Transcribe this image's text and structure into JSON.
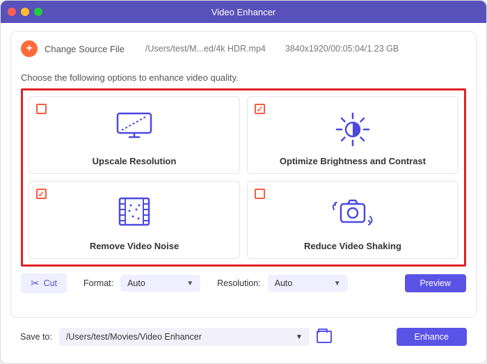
{
  "titlebar": {
    "title": "Video Enhancer"
  },
  "source": {
    "change_label": "Change Source File",
    "path": "/Users/test/M...ed/4k HDR.mp4",
    "meta": "3840x1920/00:05:04/1.23 GB"
  },
  "choose_label": "Choose the following options to enhance video quality.",
  "options": {
    "upscale": {
      "title": "Upscale Resolution",
      "checked": false
    },
    "brightness": {
      "title": "Optimize Brightness and Contrast",
      "checked": true
    },
    "noise": {
      "title": "Remove Video Noise",
      "checked": true
    },
    "shaking": {
      "title": "Reduce Video Shaking",
      "checked": false
    }
  },
  "toolbar": {
    "cut_label": "Cut",
    "format_label": "Format:",
    "format_value": "Auto",
    "resolution_label": "Resolution:",
    "resolution_value": "Auto",
    "preview_label": "Preview"
  },
  "save": {
    "label": "Save to:",
    "path": "/Users/test/Movies/Video Enhancer",
    "enhance_label": "Enhance"
  }
}
